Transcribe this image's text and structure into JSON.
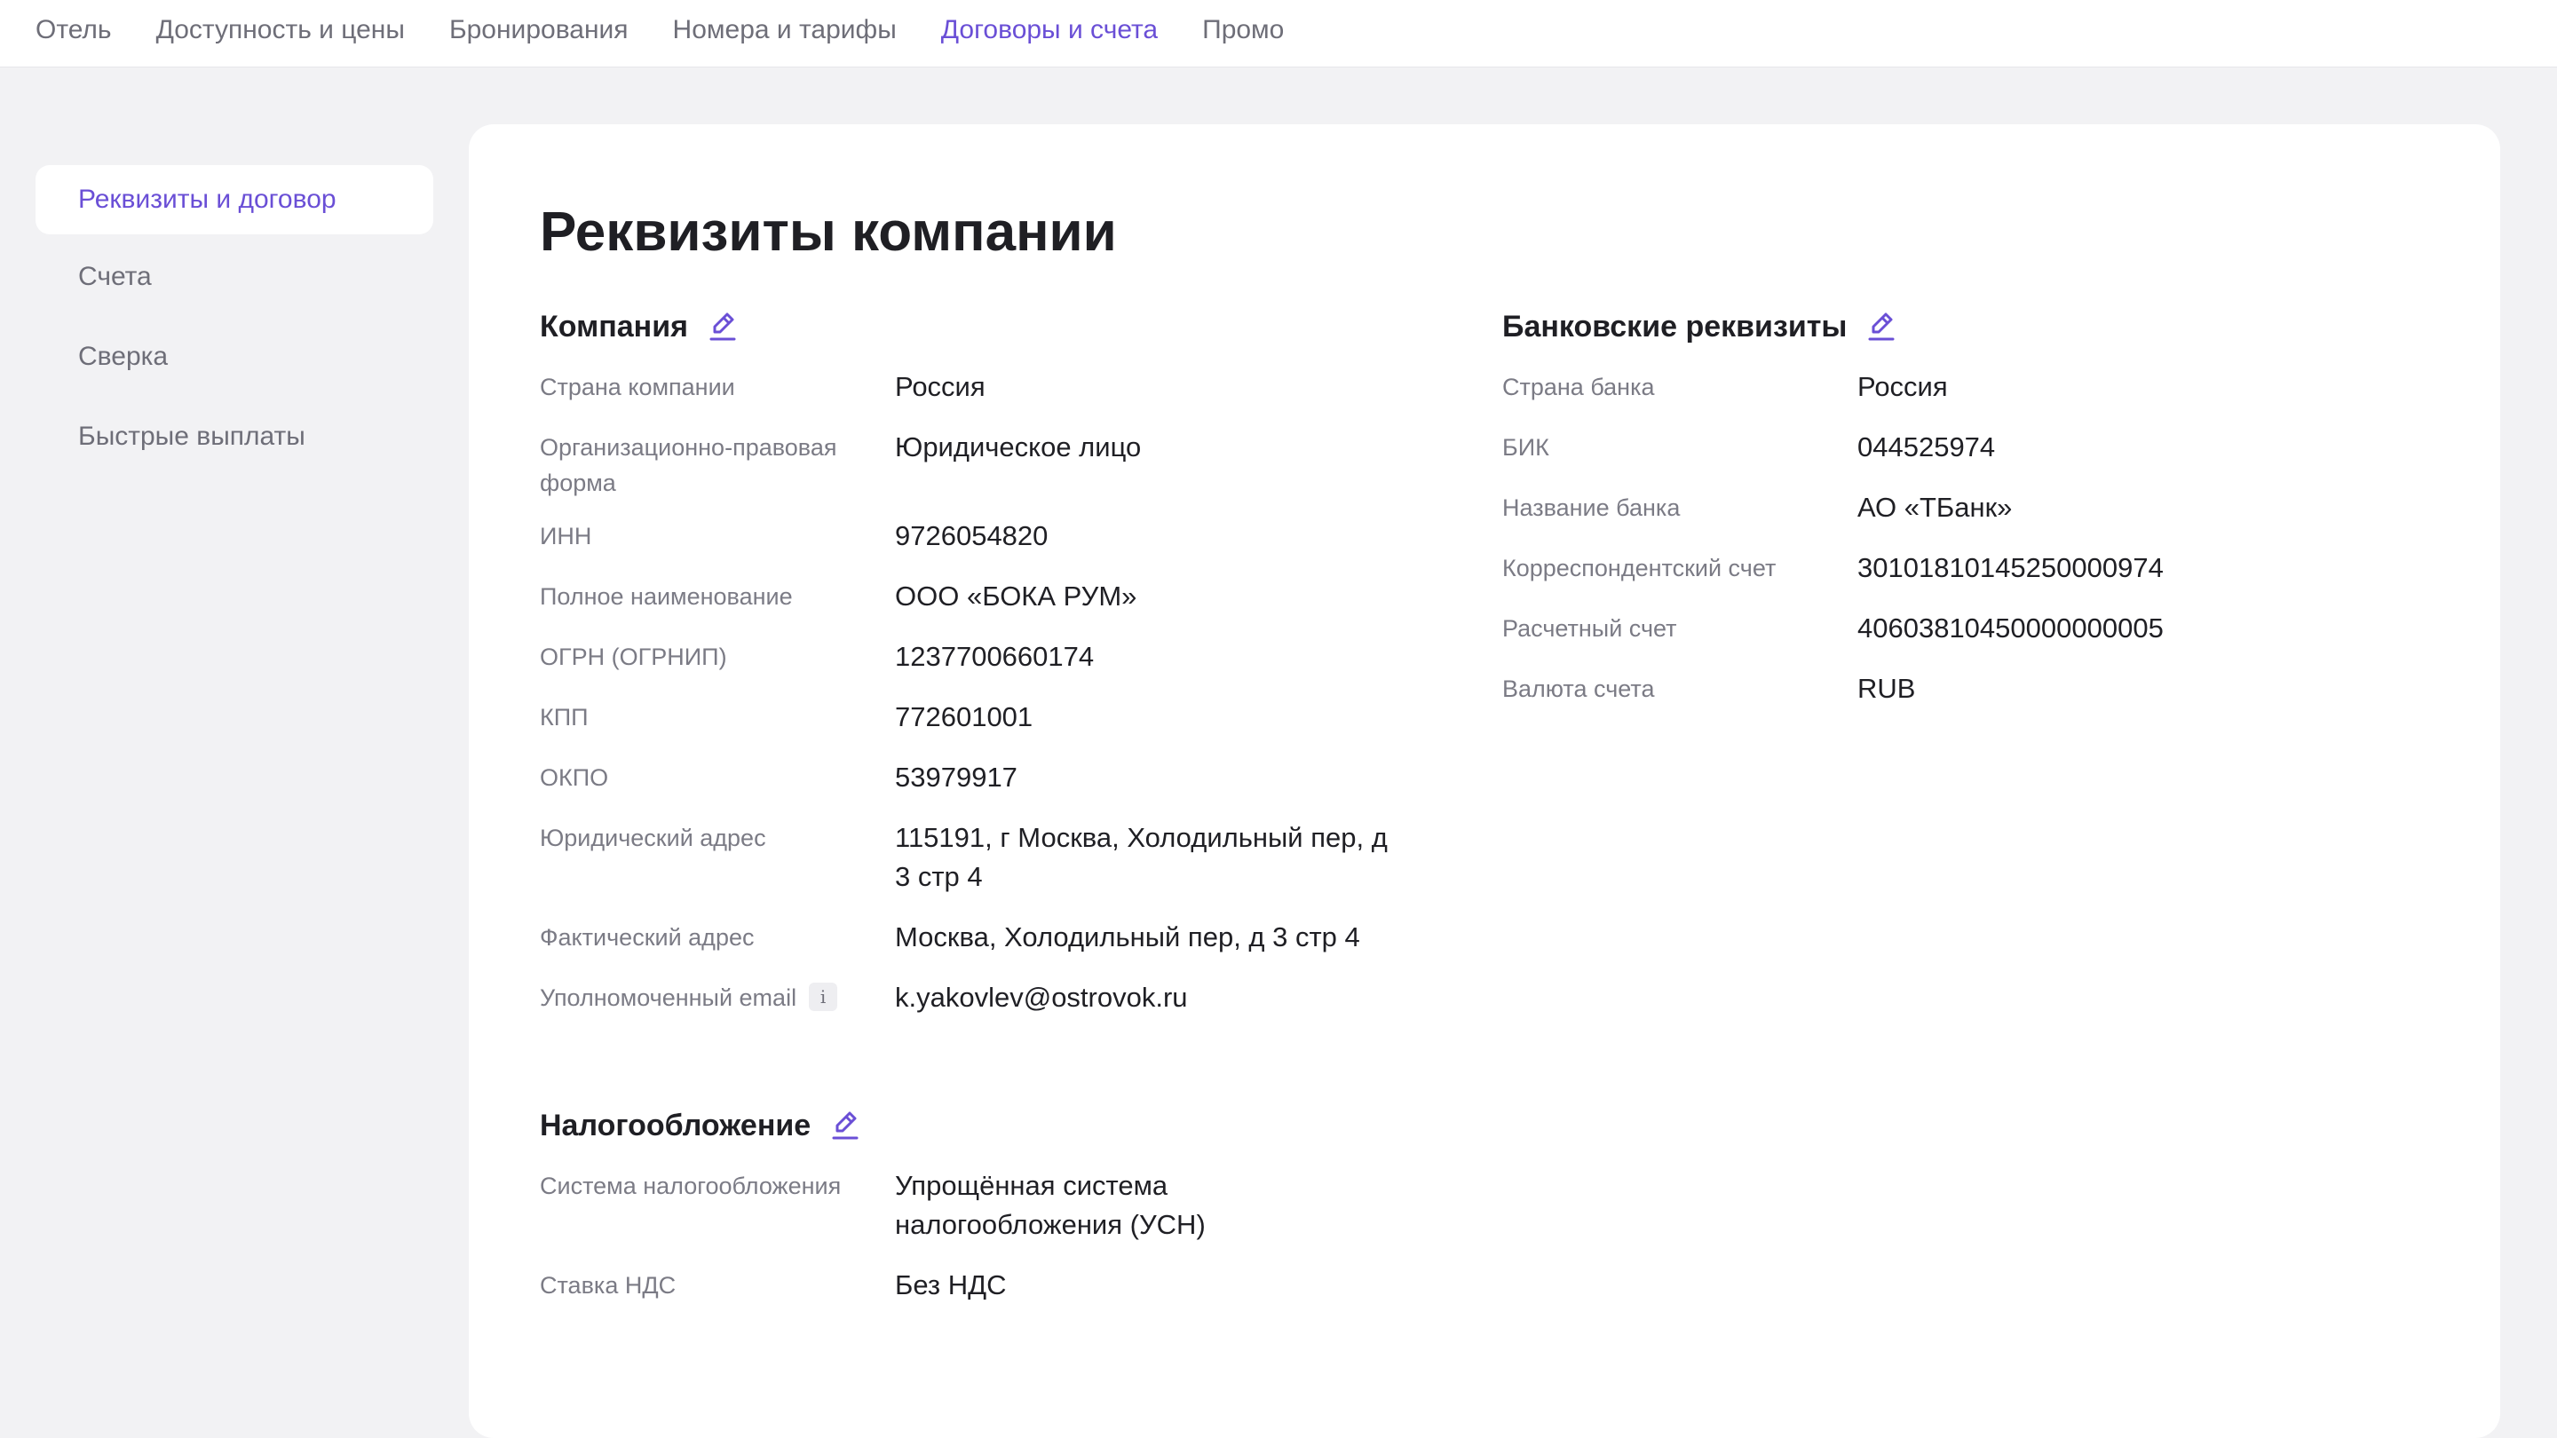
{
  "topnav": {
    "tabs": [
      {
        "label": "Отель",
        "active": false
      },
      {
        "label": "Доступность и цены",
        "active": false
      },
      {
        "label": "Бронирования",
        "active": false
      },
      {
        "label": "Номера и тарифы",
        "active": false
      },
      {
        "label": "Договоры и счета",
        "active": true
      },
      {
        "label": "Промо",
        "active": false
      }
    ]
  },
  "sidemenu": {
    "items": [
      {
        "label": "Реквизиты и договор",
        "active": true
      },
      {
        "label": "Счета",
        "active": false
      },
      {
        "label": "Сверка",
        "active": false
      },
      {
        "label": "Быстрые выплаты",
        "active": false
      }
    ]
  },
  "page": {
    "title": "Реквизиты компании"
  },
  "company": {
    "title": "Компания",
    "rows": [
      {
        "label": "Страна компании",
        "value": "Россия"
      },
      {
        "label": "Организационно-правовая форма",
        "value": "Юридическое лицо"
      },
      {
        "label": "ИНН",
        "value": "9726054820"
      },
      {
        "label": "Полное наименование",
        "value": "ООО «БОКА РУМ»"
      },
      {
        "label": "ОГРН (ОГРНИП)",
        "value": "1237700660174"
      },
      {
        "label": "КПП",
        "value": "772601001"
      },
      {
        "label": "ОКПО",
        "value": "53979917"
      },
      {
        "label": "Юридический адрес",
        "value": "115191, г Москва, Холодильный пер, д 3 стр 4"
      },
      {
        "label": "Фактический адрес",
        "value": "Москва, Холодильный пер, д 3 стр 4"
      },
      {
        "label": "Уполномоченный email",
        "value": "k.yakovlev@ostrovok.ru"
      }
    ],
    "info_icon_glyph": "i"
  },
  "bank": {
    "title": "Банковские реквизиты",
    "rows": [
      {
        "label": "Страна банка",
        "value": "Россия"
      },
      {
        "label": "БИК",
        "value": "044525974"
      },
      {
        "label": "Название банка",
        "value": "АО «ТБанк»"
      },
      {
        "label": "Корреспондентский счет",
        "value": "30101810145250000974"
      },
      {
        "label": "Расчетный счет",
        "value": "40603810450000000005"
      },
      {
        "label": "Валюта счета",
        "value": "RUB"
      }
    ]
  },
  "tax": {
    "title": "Налогообложение",
    "rows": [
      {
        "label": "Система налогообложения",
        "value": "Упрощённая система налогообложения (УСН)"
      },
      {
        "label": "Ставка НДС",
        "value": "Без НДС"
      }
    ]
  },
  "colors": {
    "accent": "#6a4fd6",
    "muted_text": "#7b7b85",
    "page_bg": "#f2f2f4",
    "card_bg": "#ffffff"
  },
  "icons": {
    "edit": "pencil-icon",
    "info": "info-icon"
  }
}
